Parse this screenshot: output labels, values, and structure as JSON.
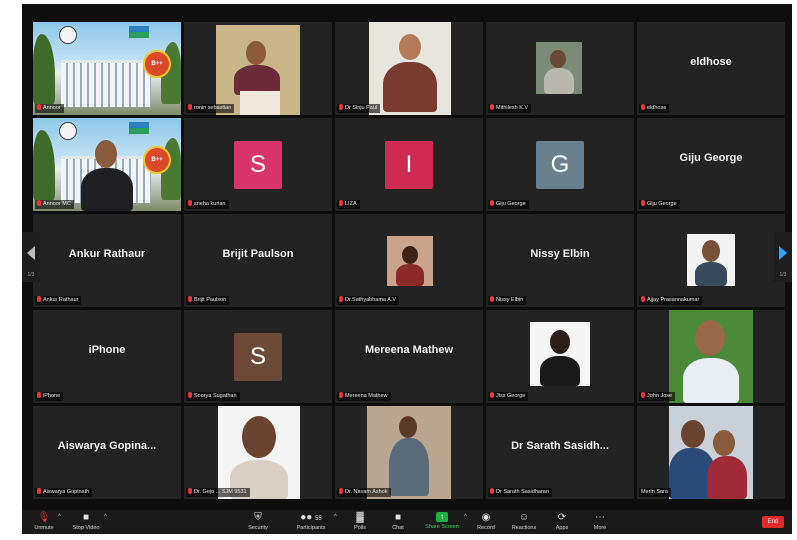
{
  "tiles": {
    "t1": {
      "label": "Annoor"
    },
    "t2": {
      "label": "ronin sebastian"
    },
    "t3": {
      "label": "Dr Sinju Paul"
    },
    "t4": {
      "label": "Mithilesh K.V"
    },
    "t5": {
      "name": "eldhose",
      "label": "eldhose"
    },
    "t6": {
      "label": "Annoor MC"
    },
    "t7": {
      "initial": "S",
      "label": "sneha kurian",
      "color": "#d7346b"
    },
    "t8": {
      "initial": "I",
      "label": "LIZA",
      "color": "#cf2a52"
    },
    "t9": {
      "initial": "G",
      "label": "Giju George",
      "color": "#6b7f8c"
    },
    "t10": {
      "name": "Giju George",
      "label": "Giju George"
    },
    "t11": {
      "name": "Ankur Rathaur",
      "label": "Ankur Rathaur"
    },
    "t12": {
      "name": "Brijit Paulson",
      "label": "Brijit Paulson"
    },
    "t13": {
      "label": "Dr.Sathyabhama A.V"
    },
    "t14": {
      "name": "Nissy Elbin",
      "label": "Nissy Elbin"
    },
    "t15": {
      "label": "Ajjay Prasannakumar"
    },
    "t16": {
      "name": "iPhone",
      "label": "iPhone"
    },
    "t17": {
      "initial": "S",
      "label": "Soorya Sugathan",
      "color": "#6b4a3a"
    },
    "t18": {
      "name": "Mereena Mathew",
      "label": "Mereena Mathew"
    },
    "t19": {
      "label": "Jiss George"
    },
    "t20": {
      "label": "John Jose"
    },
    "t21": {
      "name": "Aiswarya  Gopina...",
      "label": "Aiswarya Gopinath"
    },
    "t22": {
      "label": "Dr. Gejo ... SJM 9531"
    },
    "t23": {
      "label": "Dr. Navam  Ashok"
    },
    "t24": {
      "name": "Dr Sarath Sasidh...",
      "label": "Dr Sarath Sasidharan"
    },
    "t25": {
      "label": "Merin Sara"
    }
  },
  "nav": {
    "prev_page": "1/3",
    "next_page": "1/3"
  },
  "badge_text": "B++",
  "toolbar": {
    "unmute": "Unmute",
    "stop_video": "Stop Video",
    "security": "Security",
    "participants": "Participants",
    "participants_count": "55",
    "polls": "Polls",
    "chat": "Chat",
    "share_screen": "Share Screen",
    "record": "Record",
    "reactions": "Reactions",
    "apps": "Apps",
    "more": "More",
    "end": "End"
  },
  "colors": {
    "active_border": "#c4d94a",
    "share_green": "#1fb141",
    "end_red": "#e02828",
    "mic_muted": "#e33333"
  }
}
